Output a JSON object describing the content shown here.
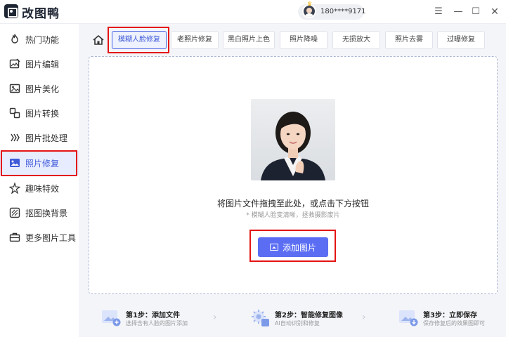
{
  "app": {
    "title": "改图鸭"
  },
  "user": {
    "phone": "180****9171"
  },
  "window": {
    "menu": "☰",
    "minimize": "—",
    "maximize": "☐",
    "close": "✕"
  },
  "sidebar": {
    "items": [
      {
        "label": "热门功能",
        "icon": "fire-icon"
      },
      {
        "label": "图片编辑",
        "icon": "edit-image-icon"
      },
      {
        "label": "图片美化",
        "icon": "beautify-icon"
      },
      {
        "label": "图片转换",
        "icon": "convert-icon"
      },
      {
        "label": "图片批处理",
        "icon": "batch-icon"
      },
      {
        "label": "照片修复",
        "icon": "photo-repair-icon",
        "active": true
      },
      {
        "label": "趣味特效",
        "icon": "effects-icon"
      },
      {
        "label": "抠图换背景",
        "icon": "cutout-icon"
      },
      {
        "label": "更多图片工具",
        "icon": "toolbox-icon"
      }
    ]
  },
  "tabs": [
    {
      "label": "模糊人脸修复",
      "active": true
    },
    {
      "label": "老照片修复"
    },
    {
      "label": "黑白照片上色"
    },
    {
      "label": "照片降噪"
    },
    {
      "label": "无损放大"
    },
    {
      "label": "照片去雾"
    },
    {
      "label": "过曝修复"
    }
  ],
  "upload": {
    "title": "将图片文件拖拽至此处，或点击下方按钮",
    "subtitle": "* 模糊人脸变清晰，拯救摄影废片",
    "button": "添加图片"
  },
  "steps": [
    {
      "title": "第1步：添加文件",
      "desc": "选择含有人脸的图片添加"
    },
    {
      "title": "第2步：智能修复图像",
      "desc": "AI自动识别和修复"
    },
    {
      "title": "第3步：立即保存",
      "desc": "保存修复后的效果图即可"
    }
  ],
  "colors": {
    "accent": "#5b6ef3",
    "active_text": "#3f5bd8",
    "highlight_box": "#e41414"
  }
}
